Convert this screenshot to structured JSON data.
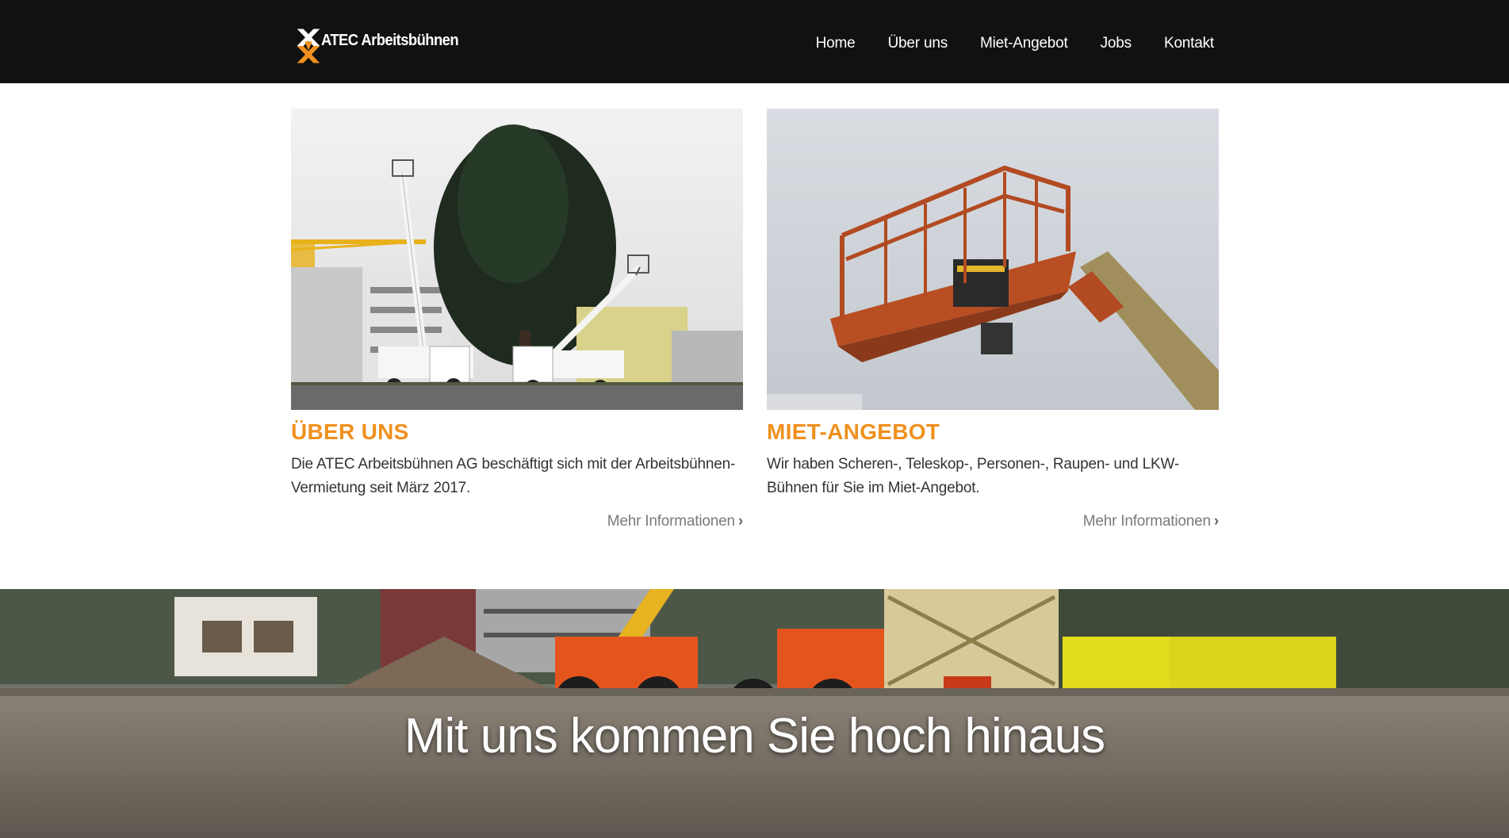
{
  "brand": {
    "name": "ATEC Arbeitsbühnen",
    "accent_color": "#f0901e",
    "header_bg": "#111111"
  },
  "nav": {
    "items": [
      {
        "label": "Home"
      },
      {
        "label": "Über uns"
      },
      {
        "label": "Miet-Angebot"
      },
      {
        "label": "Jobs"
      },
      {
        "label": "Kontakt"
      }
    ]
  },
  "cards": [
    {
      "title": "ÜBER UNS",
      "text": "Die ATEC Arbeitsbühnen AG beschäftigt sich mit der Arbeitsbühnen-Vermietung seit März 2017.",
      "more": "Mehr Informationen",
      "image": "truck-mounted aerial platforms beside a tree"
    },
    {
      "title": "MIET-ANGEBOT",
      "text": "Wir haben Scheren-, Teleskop-, Personen-, Raupen- und LKW-Bühnen für Sie im Miet-Angebot.",
      "more": "Mehr Informationen",
      "image": "orange boom lift basket against sky"
    }
  ],
  "hero": {
    "headline": "Mit uns kommen Sie hoch hinaus"
  },
  "icons": [
    "chevron-right-icon",
    "logo-x-icon"
  ]
}
